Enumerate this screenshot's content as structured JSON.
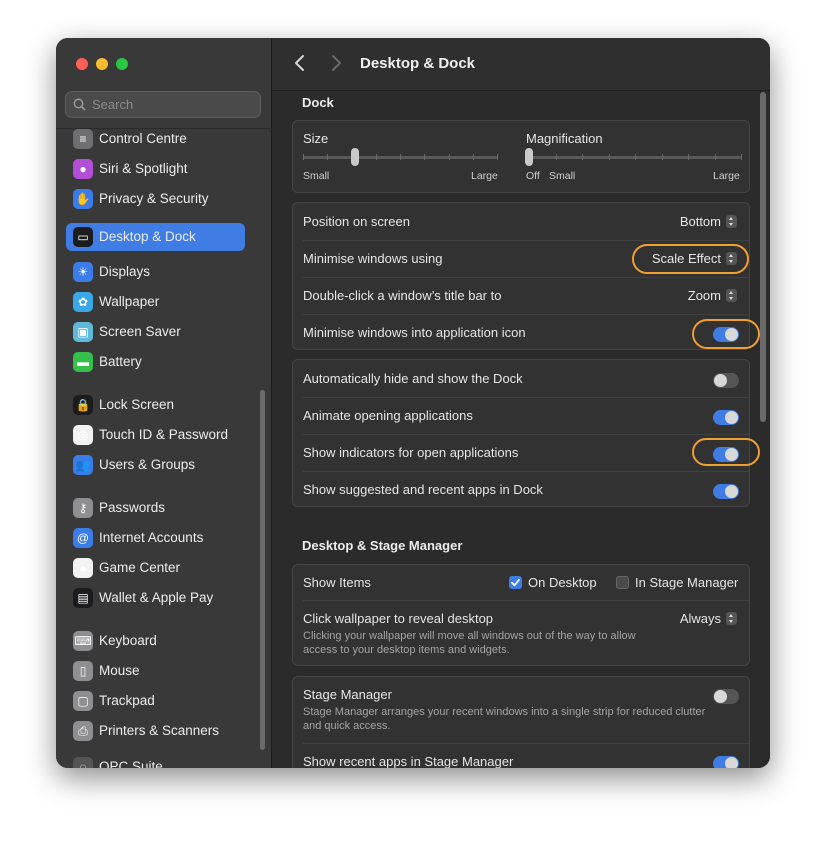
{
  "window": {
    "title": "Desktop & Dock"
  },
  "search": {
    "placeholder": "Search"
  },
  "sidebar": {
    "items": [
      {
        "label": "Control Centre",
        "icon": "control-centre-icon",
        "color": "#6e6e73"
      },
      {
        "label": "Siri & Spotlight",
        "icon": "siri-icon",
        "color": "#b34fd6"
      },
      {
        "label": "Privacy & Security",
        "icon": "hand-icon",
        "color": "#3a7ce8"
      },
      {
        "label": "Desktop & Dock",
        "icon": "dock-icon",
        "color": "#1c1c1e",
        "selected": true
      },
      {
        "label": "Displays",
        "icon": "sun-icon",
        "color": "#3a7ce8"
      },
      {
        "label": "Wallpaper",
        "icon": "flower-icon",
        "color": "#39a8e6"
      },
      {
        "label": "Screen Saver",
        "icon": "screen-saver-icon",
        "color": "#5fb9d8"
      },
      {
        "label": "Battery",
        "icon": "battery-icon",
        "color": "#35c04b"
      },
      {
        "label": "Lock Screen",
        "icon": "lock-icon",
        "color": "#1c1c1e"
      },
      {
        "label": "Touch ID & Password",
        "icon": "fingerprint-icon",
        "color": "#f2f2f2"
      },
      {
        "label": "Users & Groups",
        "icon": "users-icon",
        "color": "#3a7ce8"
      },
      {
        "label": "Passwords",
        "icon": "key-icon",
        "color": "#8e8e93"
      },
      {
        "label": "Internet Accounts",
        "icon": "at-icon",
        "color": "#3a7ce8"
      },
      {
        "label": "Game Center",
        "icon": "game-center-icon",
        "color": "#f2f2f2"
      },
      {
        "label": "Wallet & Apple Pay",
        "icon": "wallet-icon",
        "color": "#1c1c1e"
      },
      {
        "label": "Keyboard",
        "icon": "keyboard-icon",
        "color": "#8e8e93"
      },
      {
        "label": "Mouse",
        "icon": "mouse-icon",
        "color": "#8e8e93"
      },
      {
        "label": "Trackpad",
        "icon": "trackpad-icon",
        "color": "#8e8e93"
      },
      {
        "label": "Printers & Scanners",
        "icon": "printer-icon",
        "color": "#8e8e93"
      },
      {
        "label": "QPC Suite",
        "icon": "qpc-icon",
        "color": "#555555"
      }
    ]
  },
  "dock": {
    "heading": "Dock",
    "size": {
      "label": "Size",
      "min": "Small",
      "max": "Large",
      "value": 0.27
    },
    "magnification": {
      "label": "Magnification",
      "off": "Off",
      "min": "Small",
      "max": "Large",
      "value": 0.0
    },
    "position": {
      "label": "Position on screen",
      "value": "Bottom"
    },
    "minimise_using": {
      "label": "Minimise windows using",
      "value": "Scale Effect"
    },
    "double_click": {
      "label": "Double-click a window’s title bar to",
      "value": "Zoom"
    },
    "minimise_into_icon": {
      "label": "Minimise windows into application icon",
      "on": true
    },
    "auto_hide": {
      "label": "Automatically hide and show the Dock",
      "on": false
    },
    "animate": {
      "label": "Animate opening applications",
      "on": true
    },
    "indicators": {
      "label": "Show indicators for open applications",
      "on": true
    },
    "suggested": {
      "label": "Show suggested and recent apps in Dock",
      "on": true
    }
  },
  "desktop": {
    "heading": "Desktop & Stage Manager",
    "show_items": {
      "label": "Show Items",
      "on_desktop": "On Desktop",
      "in_stage": "In Stage Manager",
      "on_desktop_checked": true,
      "in_stage_checked": false
    },
    "click_wallpaper": {
      "label": "Click wallpaper to reveal desktop",
      "value": "Always",
      "desc": "Clicking your wallpaper will move all windows out of the way to allow access to your desktop items and widgets."
    },
    "stage_manager": {
      "label": "Stage Manager",
      "on": false,
      "desc": "Stage Manager arranges your recent windows into a single strip for reduced clutter and quick access."
    },
    "recent_apps": {
      "label": "Show recent apps in Stage Manager",
      "on": true
    }
  },
  "colors": {
    "accent": "#3f7de5",
    "highlight": "#f0a030"
  }
}
